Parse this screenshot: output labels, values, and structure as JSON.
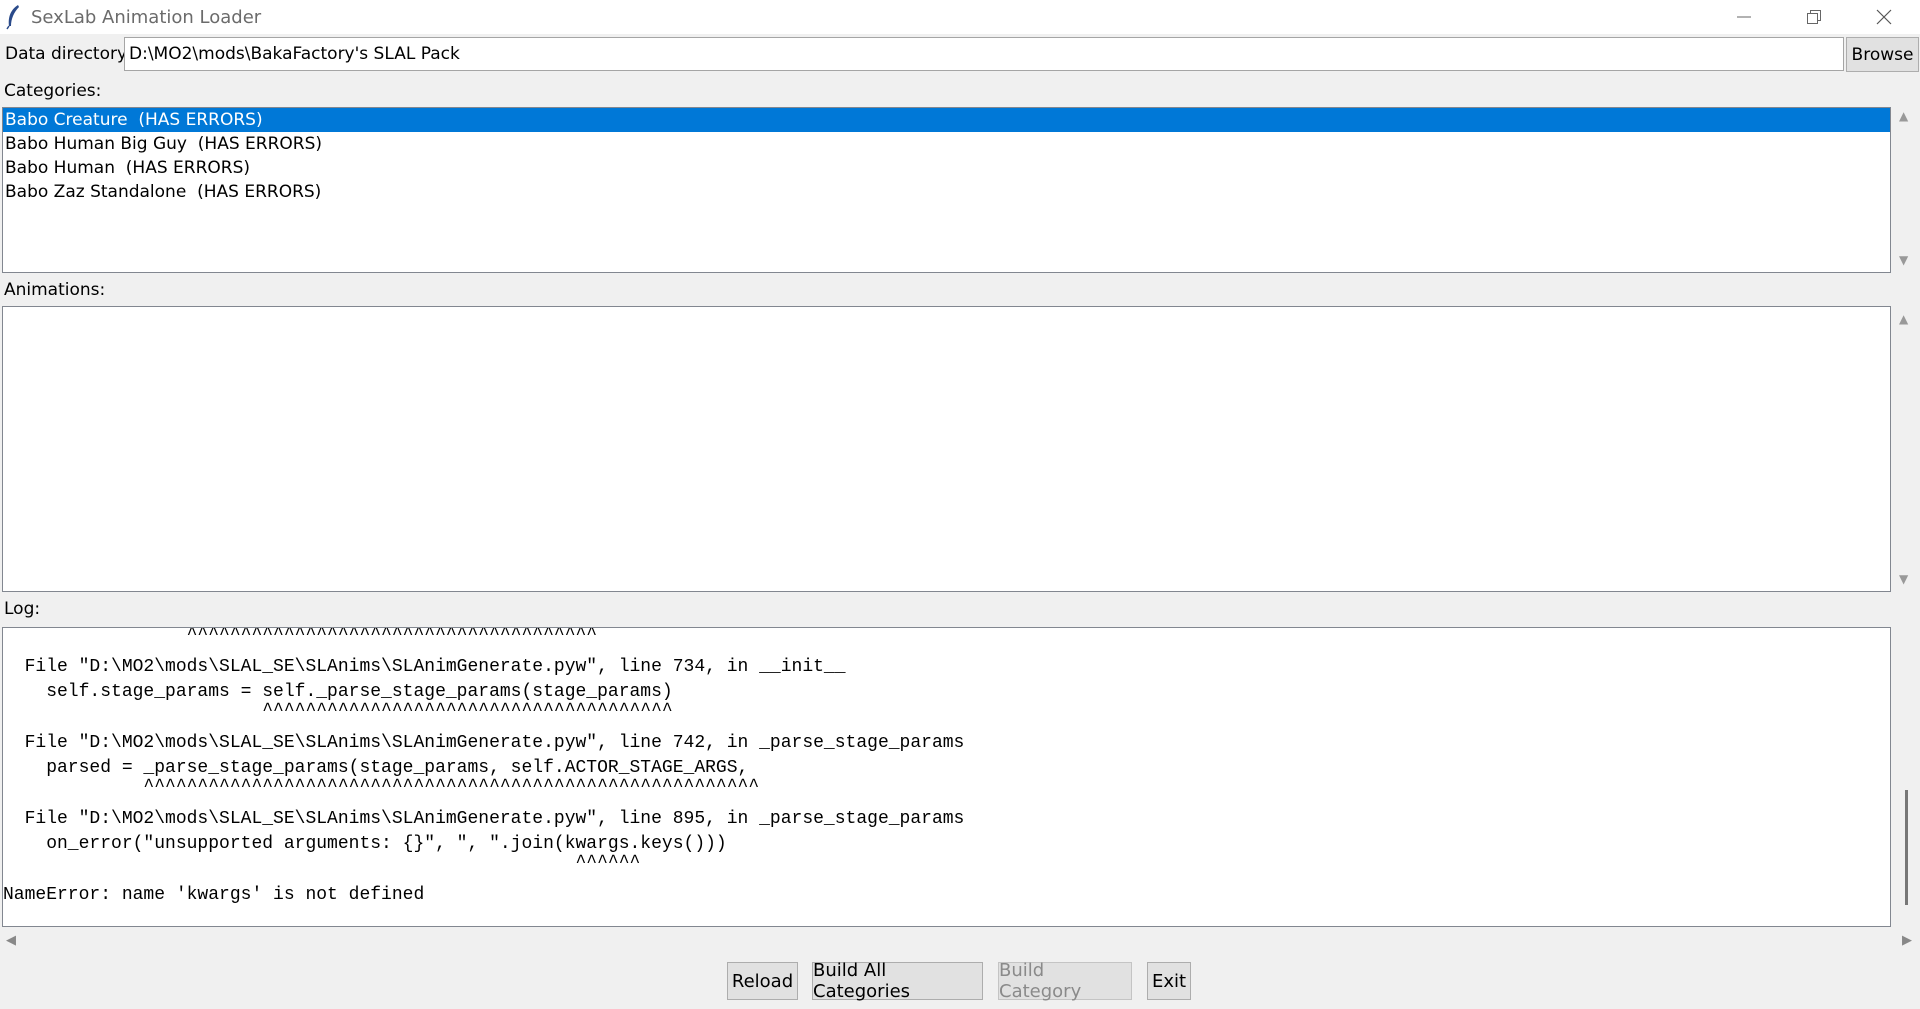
{
  "window": {
    "title": "SexLab Animation Loader"
  },
  "data_dir": {
    "label": "Data directory:",
    "value": "D:\\MO2\\mods\\BakaFactory's SLAL Pack",
    "browse": "Browse"
  },
  "categories": {
    "label": "Categories:",
    "items": [
      "Babo Creature  (HAS ERRORS)",
      "Babo Human Big Guy  (HAS ERRORS)",
      "Babo Human  (HAS ERRORS)",
      "Babo Zaz Standalone  (HAS ERRORS)"
    ],
    "selected_index": 0
  },
  "animations": {
    "label": "Animations:"
  },
  "log": {
    "label": "Log:",
    "lines": [
      "                 ^^^^^^^^^^^^^^^^^^^^^^^^^^^^^^^^^^^^^^",
      "  File \"D:\\MO2\\mods\\SLAL_SE\\SLAnims\\SLAnimGenerate.pyw\", line 734, in __init__",
      "    self.stage_params = self._parse_stage_params(stage_params)",
      "                        ^^^^^^^^^^^^^^^^^^^^^^^^^^^^^^^^^^^^^^",
      "  File \"D:\\MO2\\mods\\SLAL_SE\\SLAnims\\SLAnimGenerate.pyw\", line 742, in _parse_stage_params",
      "    parsed = _parse_stage_params(stage_params, self.ACTOR_STAGE_ARGS,",
      "             ^^^^^^^^^^^^^^^^^^^^^^^^^^^^^^^^^^^^^^^^^^^^^^^^^^^^^^^^^",
      "  File \"D:\\MO2\\mods\\SLAL_SE\\SLAnims\\SLAnimGenerate.pyw\", line 895, in _parse_stage_params",
      "    on_error(\"unsupported arguments: {}\", \", \".join(kwargs.keys()))",
      "                                                     ^^^^^^",
      "NameError: name 'kwargs' is not defined"
    ]
  },
  "buttons": {
    "reload": "Reload",
    "build_all": "Build All Categories",
    "build_category": "Build Category",
    "exit": "Exit"
  }
}
